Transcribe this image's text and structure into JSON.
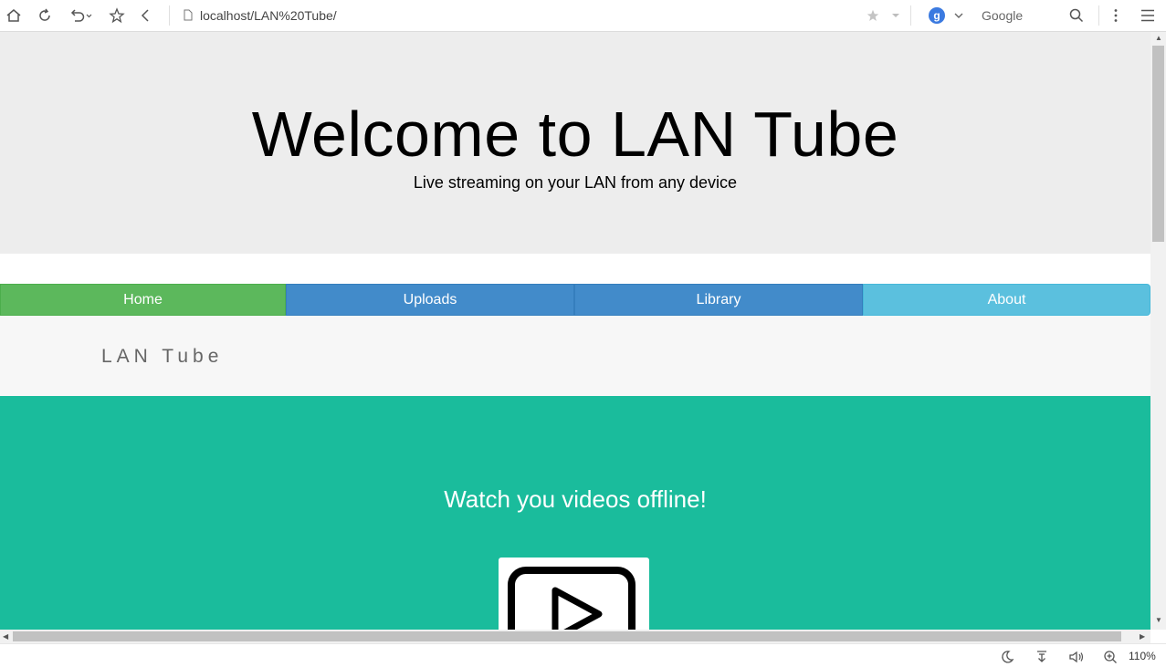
{
  "browser": {
    "url": "localhost/LAN%20Tube/",
    "search_engine": "Google",
    "search_badge": "g",
    "zoom": "110%"
  },
  "page": {
    "hero": {
      "title": "Welcome to LAN Tube",
      "subtitle": "Live streaming on your LAN from any device"
    },
    "nav": {
      "items": [
        {
          "label": "Home",
          "color": "#5cb85c"
        },
        {
          "label": "Uploads",
          "color": "#428bca"
        },
        {
          "label": "Library",
          "color": "#428bca"
        },
        {
          "label": "About",
          "color": "#5bc0de"
        }
      ]
    },
    "brand": "LAN Tube",
    "feature": {
      "heading": "Watch you videos offline!",
      "bg_color": "#1abc9c",
      "icon": "play-icon"
    }
  }
}
